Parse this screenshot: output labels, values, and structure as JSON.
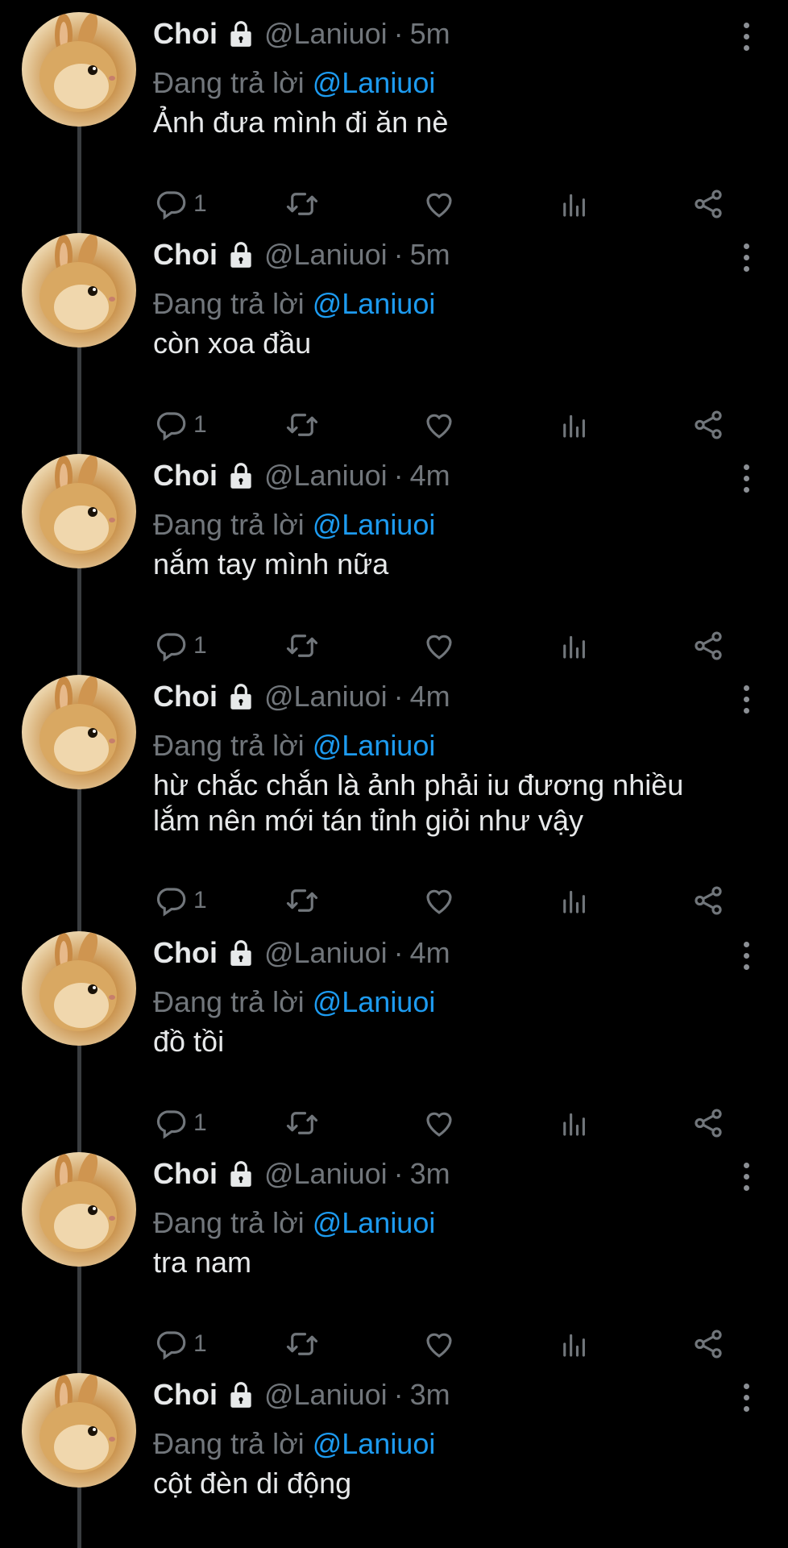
{
  "tweets": [
    {
      "name": "Choi",
      "handle": "@Laniuoi",
      "separator": "·",
      "time": "5m",
      "replying_prefix": "Đang trả lời",
      "replying_to": "@Laniuoi",
      "text": "Ảnh đưa mình đi ăn nè",
      "reply_count": "1"
    },
    {
      "name": "Choi",
      "handle": "@Laniuoi",
      "separator": "·",
      "time": "5m",
      "replying_prefix": "Đang trả lời",
      "replying_to": "@Laniuoi",
      "text": "còn xoa đầu",
      "reply_count": "1"
    },
    {
      "name": "Choi",
      "handle": "@Laniuoi",
      "separator": "·",
      "time": "4m",
      "replying_prefix": "Đang trả lời",
      "replying_to": "@Laniuoi",
      "text": "nắm tay mình nữa",
      "reply_count": "1"
    },
    {
      "name": "Choi",
      "handle": "@Laniuoi",
      "separator": "·",
      "time": "4m",
      "replying_prefix": "Đang trả lời",
      "replying_to": "@Laniuoi",
      "text_lines": [
        "hừ chắc chắn là ảnh phải iu đương nhiều",
        "lắm nên mới tán tỉnh giỏi như vậy"
      ],
      "reply_count": "1"
    },
    {
      "name": "Choi",
      "handle": "@Laniuoi",
      "separator": "·",
      "time": "4m",
      "replying_prefix": "Đang trả lời",
      "replying_to": "@Laniuoi",
      "text": "đồ tồi",
      "reply_count": "1"
    },
    {
      "name": "Choi",
      "handle": "@Laniuoi",
      "separator": "·",
      "time": "3m",
      "replying_prefix": "Đang trả lời",
      "replying_to": "@Laniuoi",
      "text": "tra nam",
      "reply_count": "1"
    },
    {
      "name": "Choi",
      "handle": "@Laniuoi",
      "separator": "·",
      "time": "3m",
      "replying_prefix": "Đang trả lời",
      "replying_to": "@Laniuoi",
      "text": "cột đèn di động"
    }
  ],
  "icons": {
    "reply": "reply-icon",
    "retweet": "retweet-icon",
    "like": "like-icon",
    "views": "views-icon",
    "share": "share-icon",
    "lock": "lock-icon",
    "more": "more-vertical-icon"
  },
  "colors": {
    "background": "#000000",
    "text": "#e7e9ea",
    "muted": "#71767b",
    "mention": "#1d9bf0",
    "thread_line": "#3a3d40"
  }
}
